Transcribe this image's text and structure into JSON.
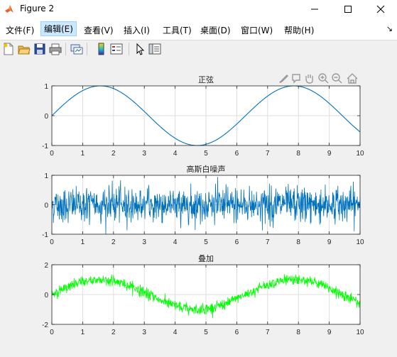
{
  "window": {
    "title": "Figure 2"
  },
  "menu": [
    "文件(F)",
    "编辑(E)",
    "查看(V)",
    "插入(I)",
    "工具(T)",
    "桌面(D)",
    "窗口(W)",
    "帮助(H)"
  ],
  "menu_selected": "编辑(E)",
  "toolbar_icons": [
    "new-figure-icon",
    "open-file-icon",
    "save-icon",
    "print-icon",
    "link-plot-icon",
    "colorbar-icon",
    "legend-icon",
    "pointer-icon",
    "property-inspector-icon"
  ],
  "axes_toolbar_icons": [
    "brush-icon",
    "data-tips-icon",
    "pan-icon",
    "zoom-in-icon",
    "zoom-out-icon",
    "home-icon"
  ],
  "colors": {
    "sine": "#0072bd",
    "noise": "#0072bd",
    "sum": "#00ff00"
  },
  "chart_data": [
    {
      "type": "line",
      "title": "正弦",
      "series": [
        {
          "formula": "y = sin(x)",
          "x_range": [
            0,
            10
          ]
        }
      ],
      "xlim": [
        0,
        10
      ],
      "ylim": [
        -1,
        1
      ],
      "xticks": [
        "0",
        "1",
        "2",
        "3",
        "4",
        "5",
        "6",
        "7",
        "8",
        "9",
        "10"
      ],
      "yticks": [
        "-1",
        "0",
        "1"
      ],
      "grid": true
    },
    {
      "type": "line",
      "title": "高斯白噪声",
      "series": [
        {
          "description": "Gaussian white noise",
          "x_range": [
            0,
            10
          ],
          "std_dev": 0.3
        }
      ],
      "xlim": [
        0,
        10
      ],
      "ylim": [
        -1,
        1
      ],
      "xticks": [
        "0",
        "1",
        "2",
        "3",
        "4",
        "5",
        "6",
        "7",
        "8",
        "9",
        "10"
      ],
      "yticks": [
        "-1",
        "0",
        "1"
      ],
      "grid": true
    },
    {
      "type": "line",
      "title": "叠加",
      "series": [
        {
          "formula": "y = sin(x) + noise",
          "x_range": [
            0,
            10
          ]
        }
      ],
      "xlim": [
        0,
        10
      ],
      "ylim": [
        -2,
        2
      ],
      "xticks": [
        "0",
        "1",
        "2",
        "3",
        "4",
        "5",
        "6",
        "7",
        "8",
        "9",
        "10"
      ],
      "yticks": [
        "-2",
        "0",
        "2"
      ],
      "grid": true
    }
  ]
}
